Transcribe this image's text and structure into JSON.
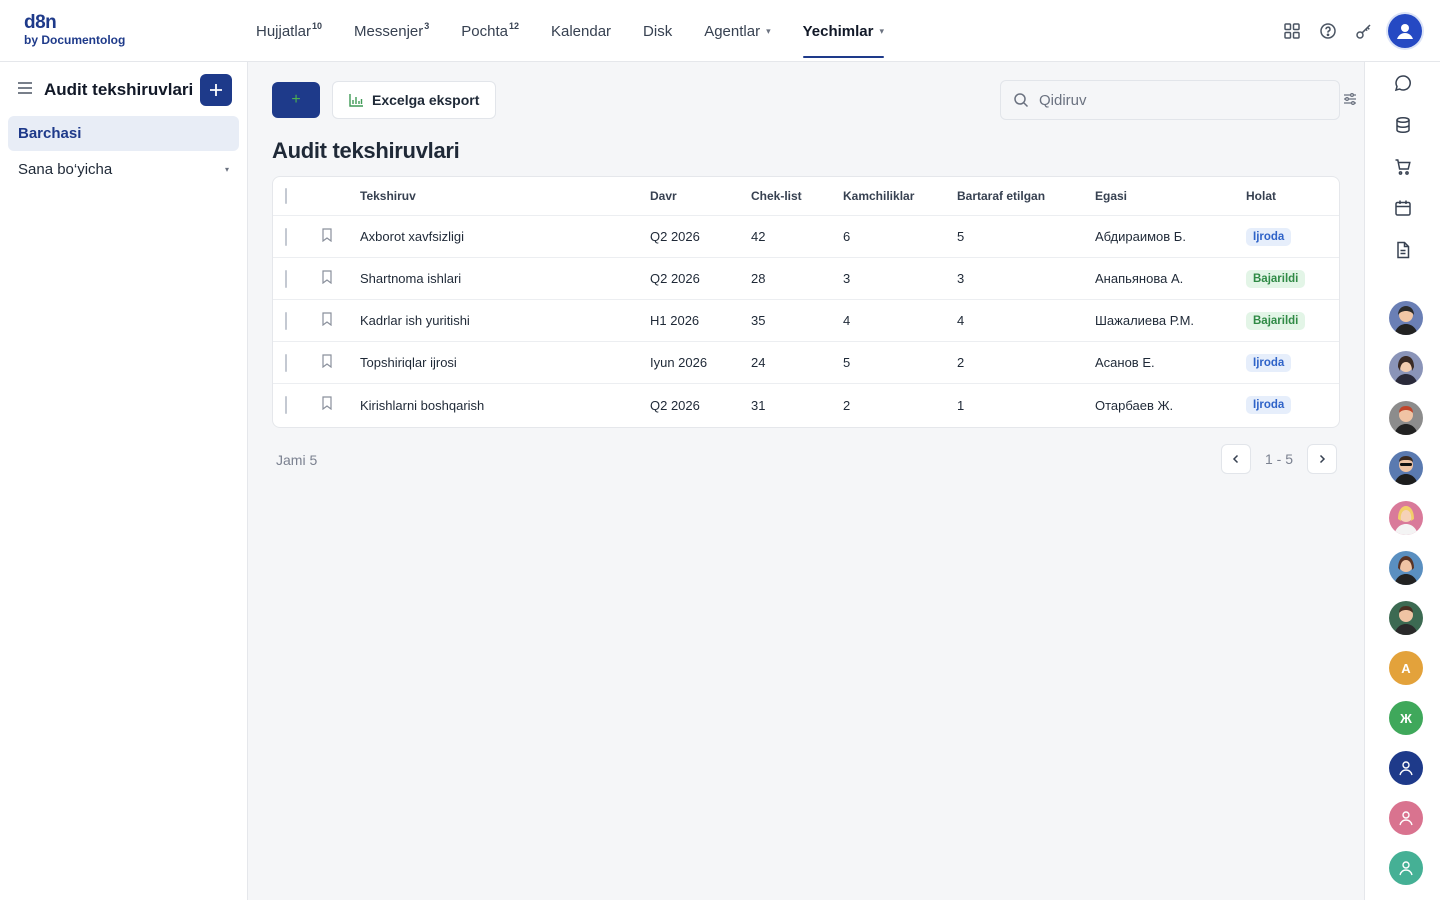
{
  "logo": {
    "line1": "d8n",
    "line2": "by Documentolog"
  },
  "nav": [
    {
      "label": "Hujjatlar",
      "badge": "10"
    },
    {
      "label": "Messenjer",
      "badge": "3"
    },
    {
      "label": "Pochta",
      "badge": "12"
    },
    {
      "label": "Kalendar",
      "badge": ""
    },
    {
      "label": "Disk",
      "badge": ""
    },
    {
      "label": "Agentlar",
      "dropdown": "▾"
    },
    {
      "label": "Yechimlar",
      "dropdown": "▾",
      "active": true
    }
  ],
  "sidebar": {
    "title": "Audit tekshiruvlari",
    "items": [
      {
        "label": "Barchasi",
        "active": true
      },
      {
        "label": "Sana bo‘yicha",
        "caret": "▾"
      }
    ]
  },
  "toolbar": {
    "add_label": "+",
    "export_label": "Excelga eksport",
    "search_placeholder": "Qidiruv"
  },
  "page_title": "Audit tekshiruvlari",
  "table": {
    "columns": [
      "Tekshiruv",
      "Davr",
      "Chek-list",
      "Kamchiliklar",
      "Bartaraf etilgan",
      "Egasi",
      "Holat"
    ],
    "rows": [
      [
        "Axborot xavfsizligi",
        "Q2 2026",
        "42",
        "6",
        "5",
        "Абдираимов Б.",
        "Ijroda"
      ],
      [
        "Shartnoma ishlari",
        "Q2 2026",
        "28",
        "3",
        "3",
        "Анапьянова А.",
        "Bajarildi"
      ],
      [
        "Kadrlar ish yuritishi",
        "H1 2026",
        "35",
        "4",
        "4",
        "Шажалиева Р.М.",
        "Bajarildi"
      ],
      [
        "Topshiriqlar ijrosi",
        "Iyun 2026",
        "24",
        "5",
        "2",
        "Асанов Е.",
        "Ijroda"
      ],
      [
        "Kirishlarni boshqarish",
        "Q2 2026",
        "31",
        "2",
        "1",
        "Отарбаев Ж.",
        "Ijroda"
      ]
    ]
  },
  "footer": {
    "total": "Jami 5",
    "range": "1 - 5"
  },
  "rail": {
    "icons": [
      "chat-icon",
      "database-icon",
      "cart-icon",
      "calendar-icon",
      "document-icon"
    ],
    "avatars": [
      {
        "type": "photo",
        "color": "#6a7fb5"
      },
      {
        "type": "photo",
        "color": "#8a94b8"
      },
      {
        "type": "photo",
        "color": "#8c8c8c"
      },
      {
        "type": "photo",
        "color": "#5a7ab0"
      },
      {
        "type": "photo",
        "color": "#d97a9a"
      },
      {
        "type": "photo",
        "color": "#5a8fc0"
      },
      {
        "type": "photo",
        "color": "#3c6a52"
      },
      {
        "type": "initial",
        "text": "A",
        "color": "#e3a23b"
      },
      {
        "type": "initial",
        "text": "Ж",
        "color": "#3fa85b"
      },
      {
        "type": "user",
        "color": "#1e3a8a"
      },
      {
        "type": "user",
        "color": "#d9738f"
      },
      {
        "type": "user",
        "color": "#45b095"
      }
    ]
  },
  "colors": {
    "primary": "#1e3a8a",
    "status_in_progress": "#2f63c8",
    "status_done": "#2f8a45"
  }
}
